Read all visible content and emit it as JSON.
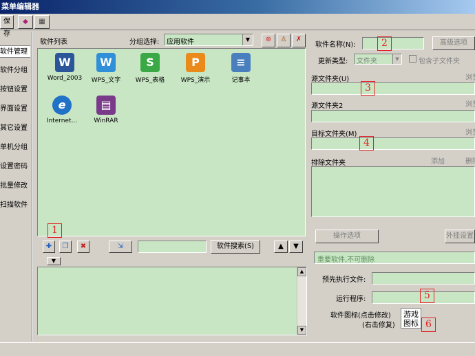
{
  "window": {
    "title": "菜单编辑器"
  },
  "toolbar": {
    "save_label": "保存"
  },
  "nav": {
    "items": [
      {
        "label": "软件管理",
        "active": true
      },
      {
        "label": "软件分组",
        "active": false
      },
      {
        "label": "按钮设置",
        "active": false
      },
      {
        "label": "界面设置",
        "active": false
      },
      {
        "label": "其它设置",
        "active": false
      },
      {
        "label": "单机分组",
        "active": false
      },
      {
        "label": "设置密码",
        "active": false
      },
      {
        "label": "批量修改",
        "active": false
      },
      {
        "label": "扫描软件",
        "active": false
      }
    ]
  },
  "software_list": {
    "title": "软件列表",
    "group_label": "分组选择:",
    "group_value": "应用软件",
    "apps": [
      {
        "label": "Word_2003",
        "glyph": "W",
        "color": "#2b579a"
      },
      {
        "label": "WPS_文字",
        "glyph": "W",
        "color": "#2f8fd8"
      },
      {
        "label": "WPS_表格",
        "glyph": "S",
        "color": "#3aa845"
      },
      {
        "label": "WPS_演示",
        "glyph": "P",
        "color": "#e98a1a"
      },
      {
        "label": "记事本",
        "glyph": "≡",
        "color": "#4a7fbf"
      },
      {
        "label": "Internet...",
        "glyph": "e",
        "color": "#1f72c6"
      },
      {
        "label": "WinRAR",
        "glyph": "▤",
        "color": "#7a3a8a"
      }
    ]
  },
  "bottom_bar": {
    "search_button": "软件搜索(S)",
    "search_value": ""
  },
  "details": {
    "name_label": "软件名称(N):",
    "advanced_button": "高级选项",
    "update_type_label": "更新类型:",
    "update_type_value": "文件夹",
    "include_subfolders_label": "包含子文件夹",
    "source_folder_label": "源文件夹(U)",
    "source_folder2_label": "源文件夹2",
    "target_folder_label": "目标文件夹(M)",
    "browse_label": "浏览",
    "exclude_folder_label": "排除文件夹",
    "add_label": "添加",
    "delete_label": "删除",
    "operation_button": "操作选项",
    "external_button": "外挂设置",
    "note_text": "重要软件,不可删除",
    "pre_exec_label": "预先执行文件:",
    "run_program_label": "运行程序:",
    "icon_label_line1": "软件图标(点击修改)",
    "icon_label_line2": "(右击修复)",
    "icon_preview_line1": "游戏",
    "icon_preview_line2": "图标"
  },
  "markers": [
    "1",
    "2",
    "3",
    "4",
    "5",
    "6"
  ]
}
